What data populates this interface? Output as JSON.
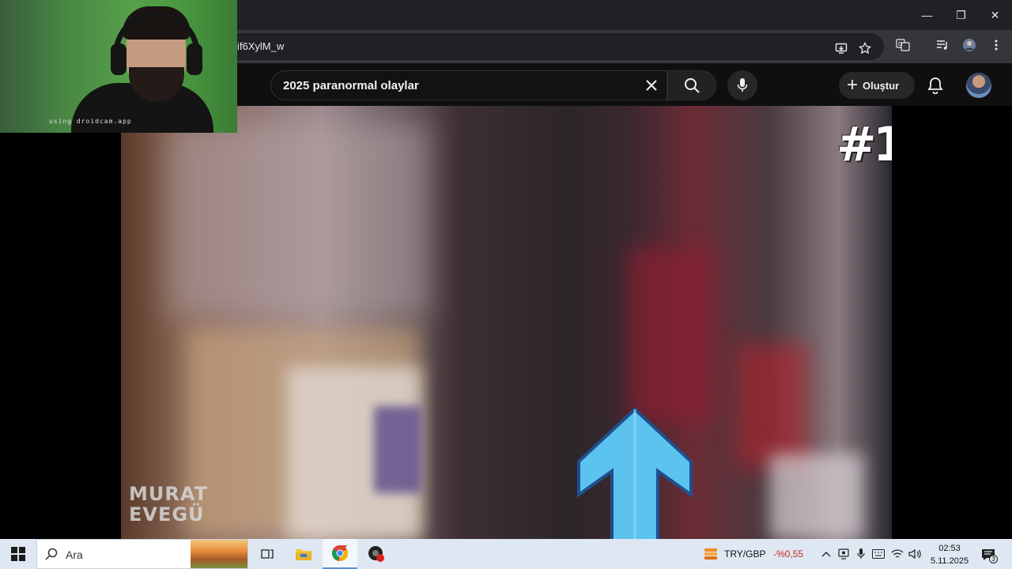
{
  "browser": {
    "url": "if6XylM_w",
    "window_controls": {
      "minimize": "—",
      "restore": "❐",
      "close": "✕"
    }
  },
  "youtube": {
    "search_query": "2025 paranormal olaylar",
    "create_label": "Oluştur"
  },
  "video": {
    "rank_overlay": "#1",
    "watermark_line1": "MURAT",
    "watermark_line2": "EVEGÜ",
    "arrow_color": "#5bc3ee"
  },
  "webcam": {
    "label": "using droidcam.app"
  },
  "taskbar": {
    "search_placeholder": "Ara",
    "currency_pair": "TRY/GBP",
    "currency_change": "-%0,55",
    "time": "02:53",
    "date": "5.11.2025",
    "notification_count": "3"
  },
  "colors": {
    "youtube_bg": "#0f0f0f",
    "taskbar_bg": "#dfe8f2",
    "currency_negative": "#c42b1c"
  }
}
